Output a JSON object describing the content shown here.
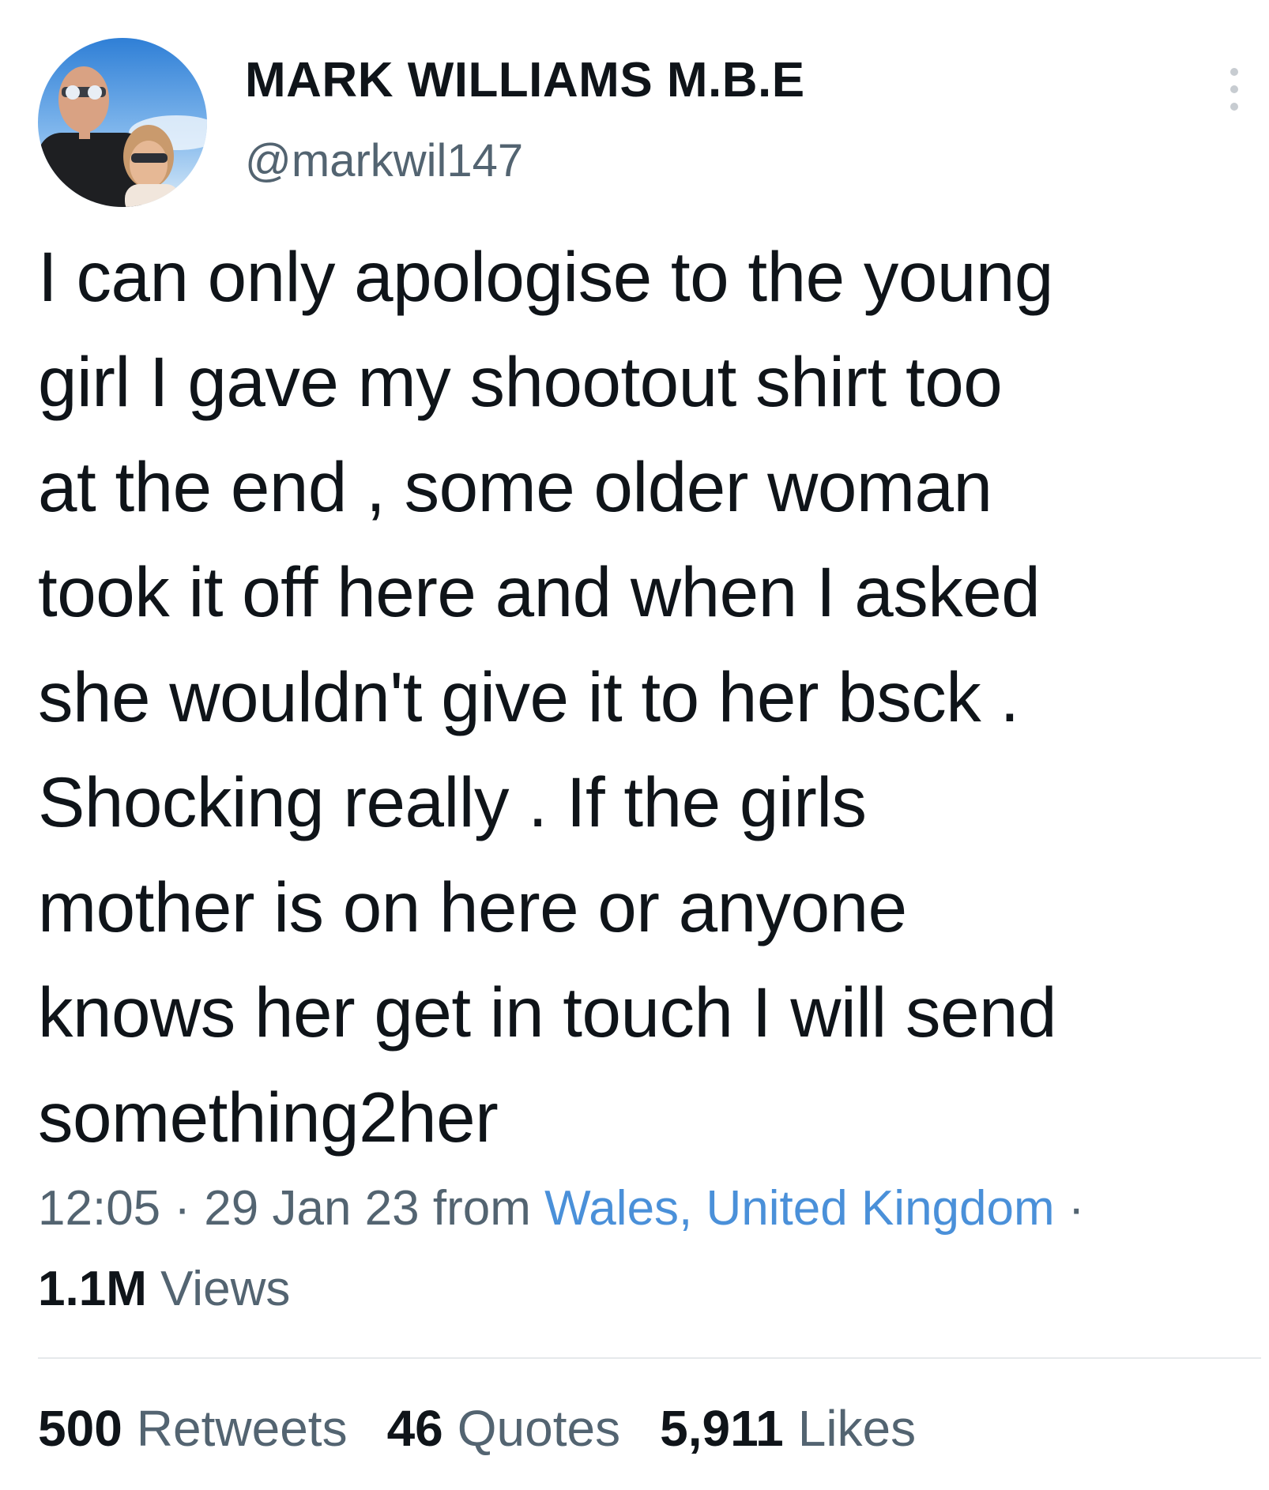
{
  "author": {
    "display_name": "MARK WILLIAMS M.B.E",
    "handle": "@markwil147",
    "avatar_icon": "profile-photo"
  },
  "more_icon": "more-vertical-icon",
  "tweet": {
    "text": "I can only apologise to the young\ngirl I gave my shootout shirt too\nat the end , some older woman\ntook it off here and when I asked\nshe wouldn't give it to her bsck .\nShocking really .  If the girls\nmother is on here or anyone\nknows her get in touch I will send\nsomething2her"
  },
  "meta": {
    "time": "12:05",
    "separator": "·",
    "date": "29 Jan 23",
    "from_label": "from",
    "location": "Wales, United Kingdom",
    "trailing_separator": "·"
  },
  "views": {
    "count": "1.1M",
    "label": "Views"
  },
  "stats": {
    "retweets": {
      "count": "500",
      "label": "Retweets"
    },
    "quotes": {
      "count": "46",
      "label": "Quotes"
    },
    "likes": {
      "count": "5,911",
      "label": "Likes"
    }
  },
  "colors": {
    "text": "#0f1419",
    "secondary": "#536471",
    "link": "#4a90d9",
    "divider": "#e6e9eb"
  }
}
